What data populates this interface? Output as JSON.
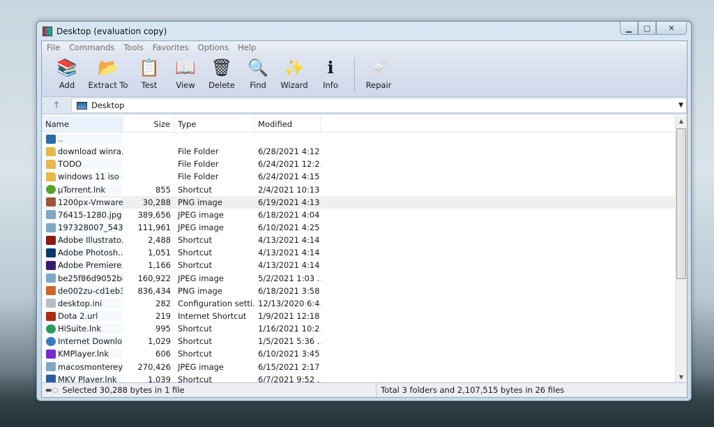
{
  "window": {
    "title": "Desktop (evaluation copy)",
    "controls": {
      "minimize": "▁",
      "maximize": "▢",
      "close": "✕"
    }
  },
  "menu": [
    "File",
    "Commands",
    "Tools",
    "Favorites",
    "Options",
    "Help"
  ],
  "toolbar": [
    {
      "label": "Add",
      "icon": "add-archive-icon",
      "glyph": "📚"
    },
    {
      "label": "Extract To",
      "icon": "extract-folder-icon",
      "glyph": "📂"
    },
    {
      "label": "Test",
      "icon": "test-clipboard-icon",
      "glyph": "📋"
    },
    {
      "label": "View",
      "icon": "view-book-icon",
      "glyph": "📖"
    },
    {
      "label": "Delete",
      "icon": "trash-icon",
      "glyph": "🗑"
    },
    {
      "label": "Find",
      "icon": "magnifier-icon",
      "glyph": "🔍"
    },
    {
      "label": "Wizard",
      "icon": "magic-wand-icon",
      "glyph": "✨"
    },
    {
      "label": "Info",
      "icon": "info-icon",
      "glyph": "ℹ"
    },
    {
      "label": "Repair",
      "icon": "repair-icon",
      "glyph": "🩹"
    }
  ],
  "address": {
    "up": "↑",
    "path": "Desktop",
    "dropdown": "▼"
  },
  "columns": {
    "name": "Name",
    "size": "Size",
    "type": "Type",
    "modified": "Modified",
    "sort_indicator": "^"
  },
  "files": [
    {
      "name": "..",
      "size": "",
      "type": "",
      "modified": "",
      "icon": "monitor",
      "color": "#2e6aa8"
    },
    {
      "name": "download winra...",
      "size": "",
      "type": "File Folder",
      "modified": "6/28/2021 4:12 ...",
      "icon": "folder",
      "color": "#e8b84a"
    },
    {
      "name": "TODO",
      "size": "",
      "type": "File Folder",
      "modified": "6/24/2021 12:2...",
      "icon": "folder",
      "color": "#e8b84a"
    },
    {
      "name": "windows 11 iso ...",
      "size": "",
      "type": "File Folder",
      "modified": "6/24/2021 4:15 ...",
      "icon": "folder",
      "color": "#e8b84a"
    },
    {
      "name": "µTorrent.lnk",
      "size": "855",
      "type": "Shortcut",
      "modified": "2/4/2021 10:13 ...",
      "icon": "utorrent",
      "color": "#5aa02c"
    },
    {
      "name": "1200px-Vmware...",
      "size": "30,288",
      "type": "PNG image",
      "modified": "6/19/2021 4:13 ...",
      "icon": "png",
      "color": "#a0523a",
      "selected": true
    },
    {
      "name": "76415-1280.jpg",
      "size": "389,656",
      "type": "JPEG image",
      "modified": "6/18/2021 4:04 ...",
      "icon": "jpeg",
      "color": "#7fa8c8"
    },
    {
      "name": "197328007_5439...",
      "size": "111,961",
      "type": "JPEG image",
      "modified": "6/10/2021 4:25 ...",
      "icon": "jpeg",
      "color": "#7fa8c8"
    },
    {
      "name": "Adobe Illustrato...",
      "size": "2,488",
      "type": "Shortcut",
      "modified": "4/13/2021 4:14 ...",
      "icon": "illustrator",
      "color": "#8b1a10"
    },
    {
      "name": "Adobe Photosh...",
      "size": "1,051",
      "type": "Shortcut",
      "modified": "4/13/2021 4:14 ...",
      "icon": "photoshop",
      "color": "#0a3a6e"
    },
    {
      "name": "Adobe Premiere...",
      "size": "1,166",
      "type": "Shortcut",
      "modified": "4/13/2021 4:14 ...",
      "icon": "premiere",
      "color": "#3a1a6e"
    },
    {
      "name": "be25f86d9052b8...",
      "size": "160,922",
      "type": "JPEG image",
      "modified": "5/2/2021 1:03 ...",
      "icon": "jpeg",
      "color": "#7fa8c8"
    },
    {
      "name": "de002zu-cd1eb3...",
      "size": "836,434",
      "type": "PNG image",
      "modified": "6/18/2021 3:58 ...",
      "icon": "png",
      "color": "#d0642a"
    },
    {
      "name": "desktop.ini",
      "size": "282",
      "type": "Configuration setti...",
      "modified": "12/13/2020 6:4...",
      "icon": "ini",
      "color": "#b8bcc4"
    },
    {
      "name": "Dota 2.url",
      "size": "219",
      "type": "Internet Shortcut",
      "modified": "1/9/2021 12:18 ...",
      "icon": "dota",
      "color": "#b02a1a"
    },
    {
      "name": "HiSuite.lnk",
      "size": "995",
      "type": "Shortcut",
      "modified": "1/16/2021 10:2...",
      "icon": "hisuite",
      "color": "#2a9a5a"
    },
    {
      "name": "Internet Downlo...",
      "size": "1,029",
      "type": "Shortcut",
      "modified": "1/5/2021 5:36 ...",
      "icon": "idm",
      "color": "#3a7ac0"
    },
    {
      "name": "KMPlayer.lnk",
      "size": "606",
      "type": "Shortcut",
      "modified": "6/10/2021 3:45 ...",
      "icon": "kmplayer",
      "color": "#7a2ad0"
    },
    {
      "name": "macosmonterey...",
      "size": "270,426",
      "type": "JPEG image",
      "modified": "6/15/2021 2:17 ...",
      "icon": "jpeg",
      "color": "#7fa8c8"
    },
    {
      "name": "MKV Player.lnk",
      "size": "1,039",
      "type": "Shortcut",
      "modified": "6/7/2021 9:52 ...",
      "icon": "mkv",
      "color": "#2a5aa0"
    }
  ],
  "status": {
    "left": "Selected 30,288 bytes in 1 file",
    "right": "Total 3 folders and 2,107,515 bytes in 26 files"
  }
}
